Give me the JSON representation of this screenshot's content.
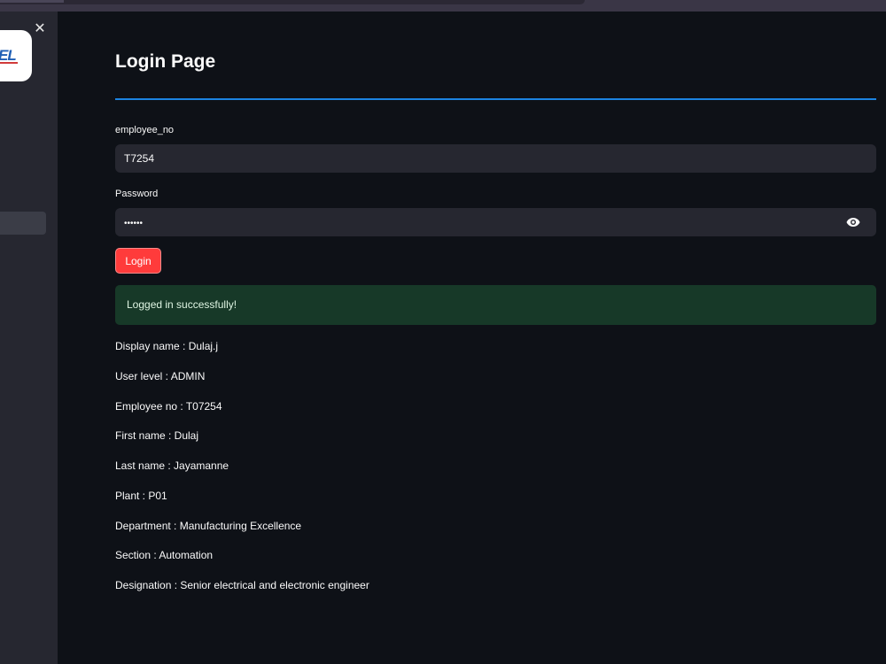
{
  "sidebar": {
    "logo_text": "EL",
    "close_icon": "close-icon"
  },
  "page": {
    "title": "Login Page"
  },
  "form": {
    "employee_label": "employee_no",
    "employee_value": "T7254",
    "password_label": "Password",
    "password_value": "••••••",
    "password_toggle_icon": "eye-icon",
    "login_label": "Login"
  },
  "status": {
    "message": "Logged in successfully!"
  },
  "user_details": [
    "Display name : Dulaj.j",
    "User level : ADMIN",
    "Employee no : T07254",
    "First name : Dulaj",
    "Last name : Jayamanne",
    "Plant : P01",
    "Department : Manufacturing Excellence",
    "Section : Automation",
    "Designation : Senior electrical and electronic engineer"
  ],
  "colors": {
    "background": "#0e1117",
    "sidebar": "#262730",
    "accent": "#1c83e1",
    "primary_button": "#ff3b3b",
    "success_background": "#173928"
  }
}
